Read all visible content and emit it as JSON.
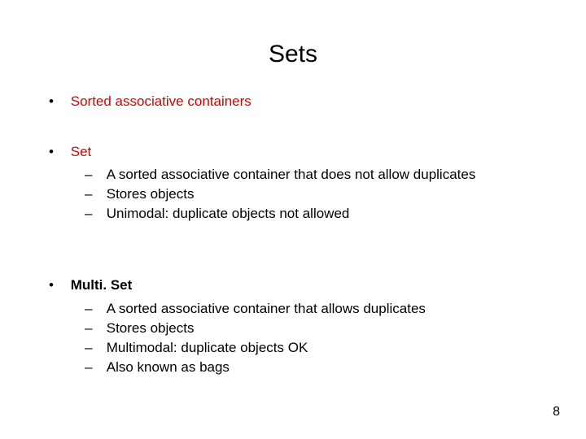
{
  "title": "Sets",
  "bullets": {
    "b0": {
      "label": "Sorted associative containers"
    },
    "b1": {
      "label": "Set",
      "subs": {
        "s0": "A sorted associative container that does not allow duplicates",
        "s1": "Stores objects",
        "s2": "Unimodal:  duplicate objects not allowed"
      }
    },
    "b2": {
      "label": "Multi. Set",
      "subs": {
        "s0": "A sorted associative container that allows duplicates",
        "s1": "Stores objects",
        "s2": "Multimodal:  duplicate objects OK",
        "s3": "Also known as bags"
      }
    }
  },
  "page_number": "8"
}
